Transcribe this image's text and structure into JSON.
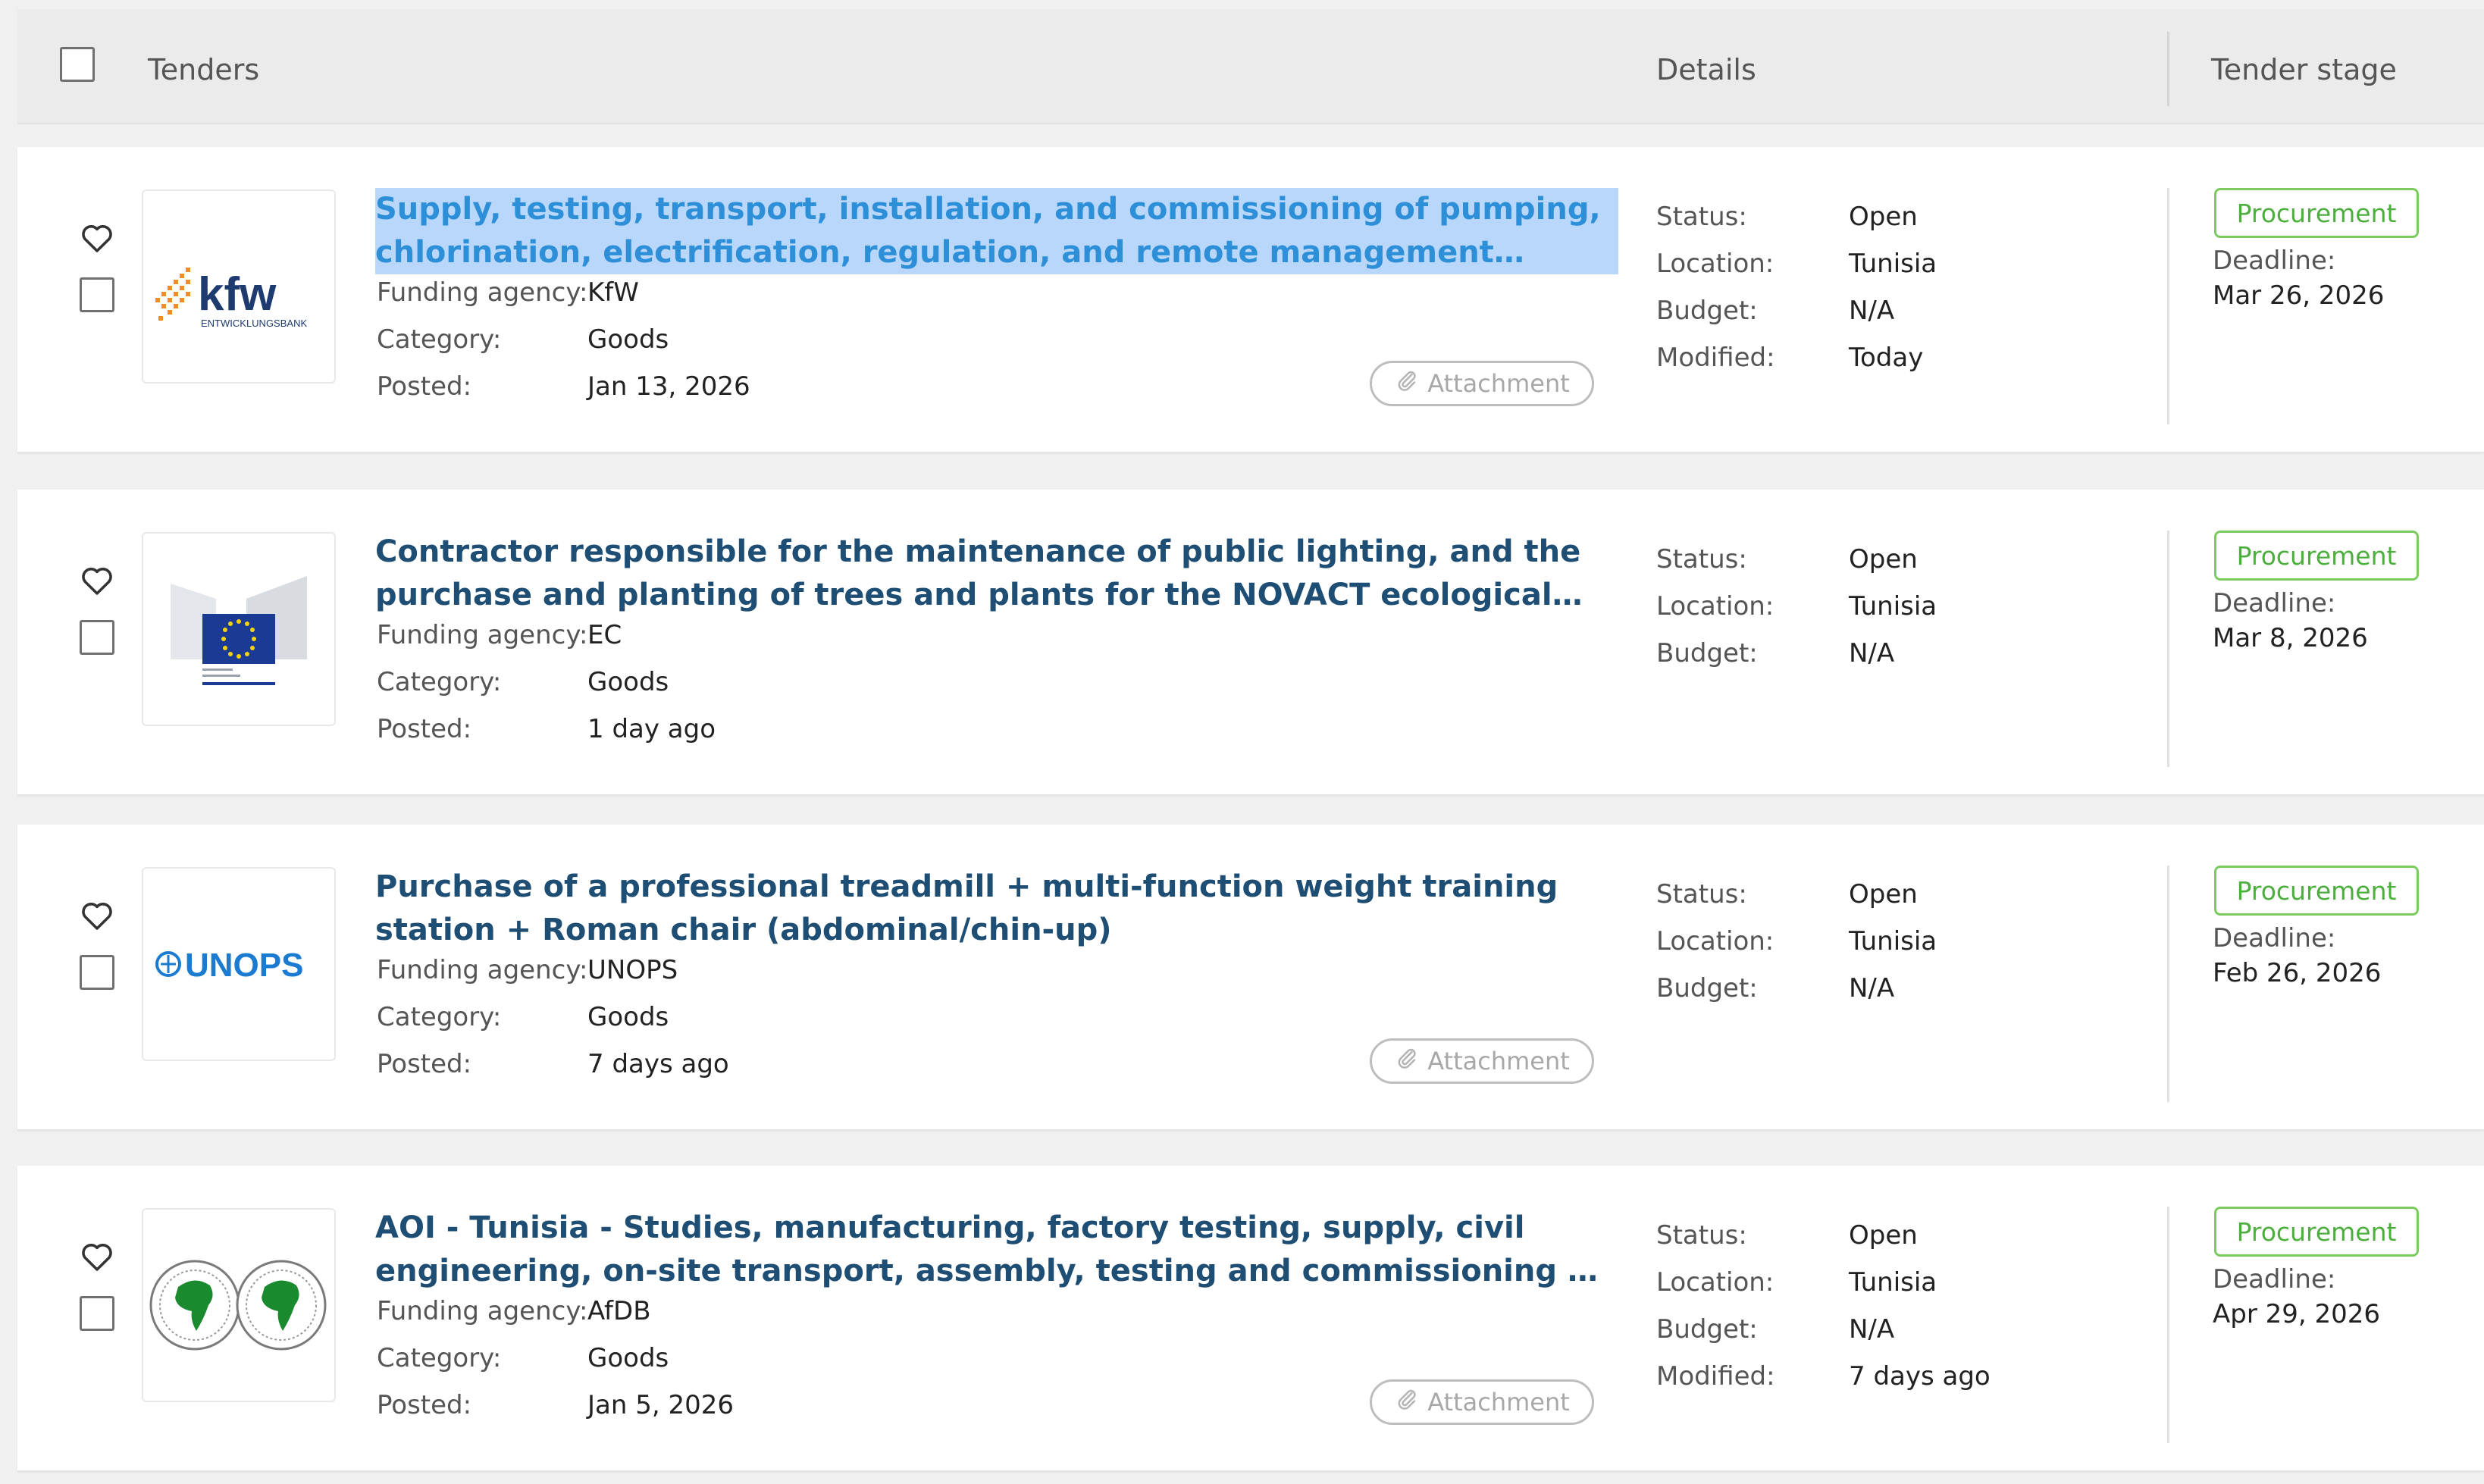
{
  "header": {
    "tenders_label": "Tenders",
    "details_label": "Details",
    "stage_label": "Tender stage"
  },
  "labels": {
    "funding_agency": "Funding agency:",
    "category": "Category:",
    "posted": "Posted:",
    "status": "Status:",
    "location": "Location:",
    "budget": "Budget:",
    "modified": "Modified:",
    "deadline": "Deadline:",
    "attachment": "Attachment"
  },
  "logos": {
    "kfw_word": "kfw",
    "kfw_sub": "ENTWICKLUNGSBANK",
    "unops_word": "UNOPS"
  },
  "colors": {
    "title": "#1f4e74",
    "selection": "#b9d7fb",
    "procurement": "#4caf3d"
  },
  "tenders": [
    {
      "title": "Supply, testing, transport, installation, and commissioning of pumping, chlorination, electrification, regulation, and remote management equipment for PNAQII Project (Tunisia)",
      "selected": true,
      "logo": "kfw-logo",
      "funding_agency": "KfW",
      "category": "Goods",
      "posted": "Jan 13, 2026",
      "status": "Open",
      "location": "Tunisia",
      "budget": "N/A",
      "modified": "Today",
      "stage": "Procurement",
      "deadline": "Mar 26, 2026",
      "has_attachment": true
    },
    {
      "title": "Contractor responsible for the maintenance of public lighting, and the purchase and planting of trees and plants for the NOVACT ecological circuit",
      "selected": false,
      "logo": "european-commission-logo",
      "funding_agency": "EC",
      "category": "Goods",
      "posted": "1 day ago",
      "status": "Open",
      "location": "Tunisia",
      "budget": "N/A",
      "modified": "",
      "stage": "Procurement",
      "deadline": "Mar 8, 2026",
      "has_attachment": false
    },
    {
      "title": "Purchase of a professional treadmill + multi-function weight training station + Roman chair (abdominal/chin-up)",
      "selected": false,
      "logo": "unops-logo",
      "funding_agency": "UNOPS",
      "category": "Goods",
      "posted": "7 days ago",
      "status": "Open",
      "location": "Tunisia",
      "budget": "N/A",
      "modified": "",
      "stage": "Procurement",
      "deadline": "Feb 26, 2026",
      "has_attachment": true
    },
    {
      "title": "AOI - Tunisia - Studies, manufacturing, factory testing, supply, civil engineering, on-site transport, assembly, testing and commissioning of isolated HTB armored substations",
      "selected": false,
      "logo": "afdb-logo",
      "funding_agency": "AfDB",
      "category": "Goods",
      "posted": "Jan 5, 2026",
      "status": "Open",
      "location": "Tunisia",
      "budget": "N/A",
      "modified": "7 days ago",
      "stage": "Procurement",
      "deadline": "Apr 29, 2026",
      "has_attachment": true
    }
  ]
}
